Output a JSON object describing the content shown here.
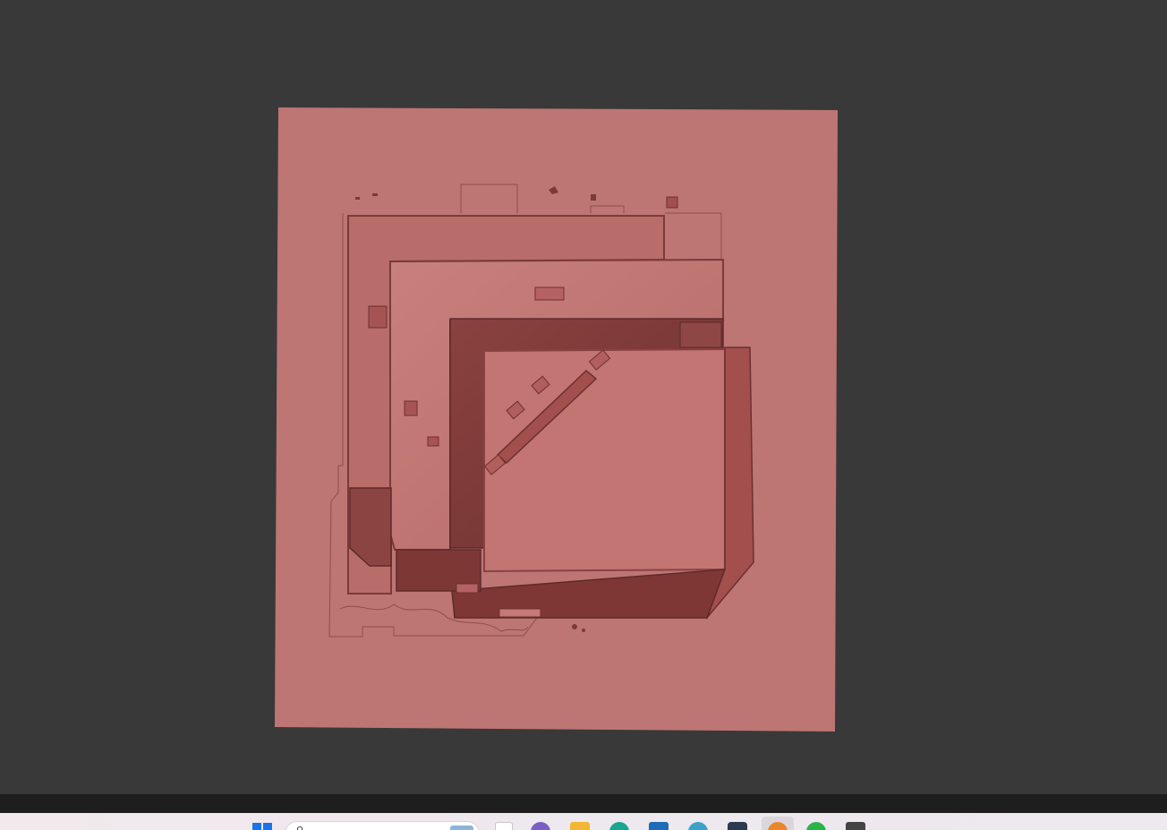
{
  "viewer": {
    "background_color": "#393939",
    "plate_color": "#bd7674",
    "relief_dark_color": "#7a3a38",
    "relief_mid_color": "#a2504e"
  },
  "taskbar": {
    "icons": [
      "windows-start-icon",
      "search-icon",
      "task-view-icon",
      "app-circle-icon",
      "file-explorer-icon",
      "edge-browser-icon",
      "store-icon",
      "chrome-icon",
      "app-dark-icon",
      "blender-icon",
      "whatsapp-icon",
      "terminal-icon"
    ],
    "colors": {
      "start": "#1a73e8",
      "app_circle": "#7b5fc0",
      "file_explorer": "#f2b632",
      "edge": "#1aa58e",
      "store": "#1e6bb8",
      "chrome": "#3ba1c7",
      "app_dark": "#2a3a50",
      "blender": "#e8862a",
      "whatsapp": "#2bb34a",
      "terminal": "#444444"
    }
  }
}
